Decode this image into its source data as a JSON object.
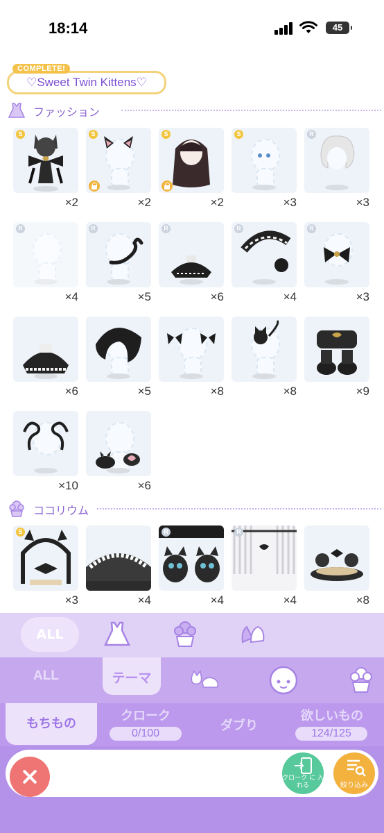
{
  "status_bar": {
    "time": "18:14",
    "battery": "45"
  },
  "theme": {
    "badge": "COMPLETE!",
    "title": "♡Sweet Twin Kittens♡"
  },
  "fashion": {
    "label": "ファッション",
    "items": [
      {
        "rarity": "S",
        "count": "×2",
        "locked": false,
        "owned": true
      },
      {
        "rarity": "S",
        "count": "×2",
        "locked": true,
        "owned": true
      },
      {
        "rarity": "S",
        "count": "×2",
        "locked": true,
        "owned": true
      },
      {
        "rarity": "S",
        "count": "×3",
        "locked": false,
        "owned": true
      },
      {
        "rarity": "R",
        "count": "×3",
        "locked": false,
        "owned": true
      },
      {
        "rarity": "R",
        "count": "×4",
        "locked": false,
        "owned": true
      },
      {
        "rarity": "R",
        "count": "×5",
        "locked": false,
        "owned": true
      },
      {
        "rarity": "R",
        "count": "×6",
        "locked": false,
        "owned": true
      },
      {
        "rarity": "R",
        "count": "×4",
        "locked": false,
        "owned": true
      },
      {
        "rarity": "R",
        "count": "×3",
        "locked": false,
        "owned": true
      },
      {
        "rarity": "",
        "count": "×6",
        "locked": false,
        "owned": true
      },
      {
        "rarity": "",
        "count": "×5",
        "locked": false,
        "owned": true
      },
      {
        "rarity": "",
        "count": "×8",
        "locked": false,
        "owned": true
      },
      {
        "rarity": "",
        "count": "×8",
        "locked": false,
        "owned": true
      },
      {
        "rarity": "",
        "count": "×9",
        "locked": false,
        "owned": true
      },
      {
        "rarity": "",
        "count": "×10",
        "locked": false,
        "owned": true
      },
      {
        "rarity": "",
        "count": "×6",
        "locked": false,
        "owned": true
      }
    ]
  },
  "kokorium": {
    "label": "ココリウム",
    "items": [
      {
        "rarity": "S",
        "count": "×3"
      },
      {
        "rarity": "",
        "count": "×4"
      },
      {
        "rarity": "R",
        "count": "×4"
      },
      {
        "rarity": "R",
        "count": "×4"
      },
      {
        "rarity": "",
        "count": "×8"
      }
    ]
  },
  "category_tabs": {
    "all": "ALL"
  },
  "sub_tabs": {
    "all": "ALL",
    "theme": "テーマ"
  },
  "bottom_tabs": {
    "mochimono": "もちもの",
    "cloak": "クローク",
    "cloak_count": "0/100",
    "duplicate": "ダブり",
    "wishlist": "欲しいもの",
    "wishlist_count": "124/125"
  },
  "actions": {
    "cloak_put": "クローク に 入れる",
    "filter": "絞り込み"
  }
}
